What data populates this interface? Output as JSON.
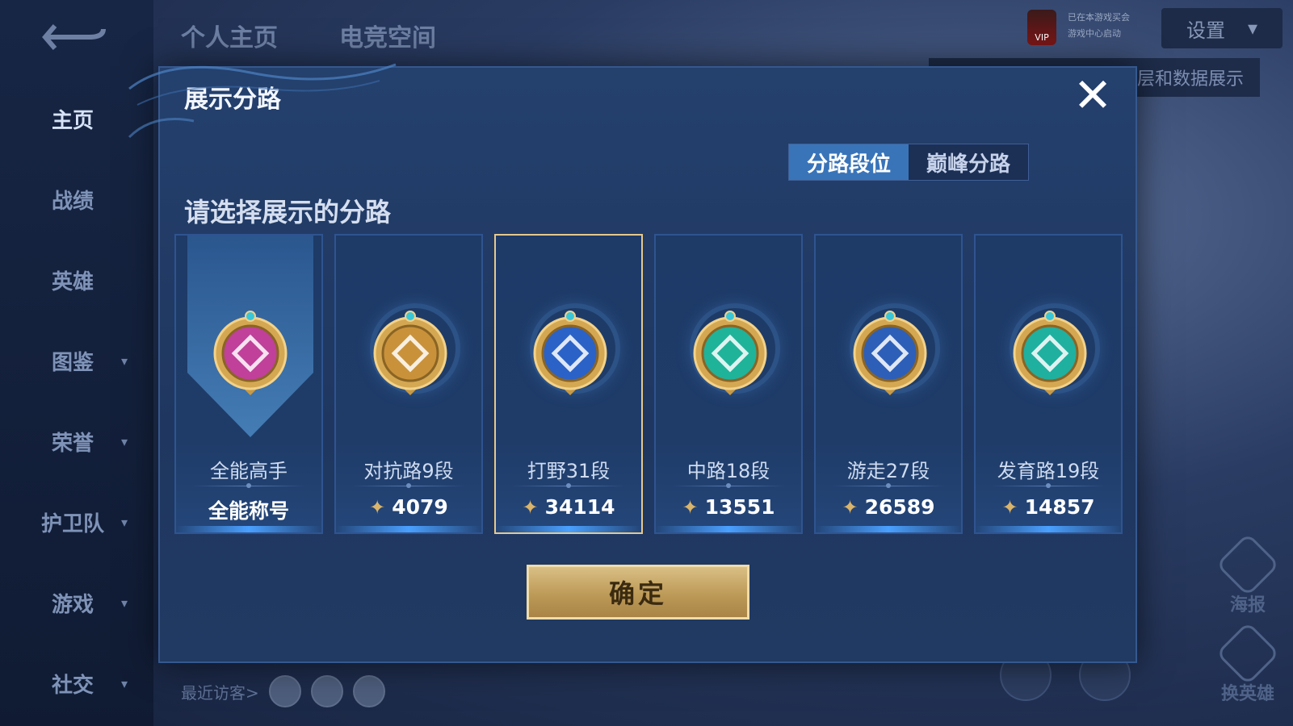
{
  "sidebar": {
    "items": [
      {
        "label": "主页",
        "has_chevron": false,
        "active": true
      },
      {
        "label": "战绩",
        "has_chevron": false
      },
      {
        "label": "英雄",
        "has_chevron": false
      },
      {
        "label": "图鉴",
        "has_chevron": true
      },
      {
        "label": "荣誉",
        "has_chevron": true
      },
      {
        "label": "护卫队",
        "has_chevron": true
      },
      {
        "label": "游戏",
        "has_chevron": true
      },
      {
        "label": "社交",
        "has_chevron": true
      }
    ]
  },
  "header": {
    "tabs": [
      "个人主页",
      "电竞空间"
    ],
    "vip_label": "VIP",
    "vip_text": [
      "已在本游戏买会",
      "游戏中心启动"
    ],
    "settings_label": "设置",
    "bg_tip": "层和数据展示"
  },
  "right_icons": [
    {
      "icon": "poster-icon",
      "label": "海报"
    },
    {
      "icon": "change-hero-icon",
      "label": "换英雄"
    }
  ],
  "visitors": {
    "label": "最近访客>"
  },
  "dialog": {
    "title": "展示分路",
    "close": "✕",
    "segments": [
      {
        "label": "分路段位",
        "selected": true
      },
      {
        "label": "巅峰分路",
        "selected": false
      }
    ],
    "prompt": "请选择展示的分路",
    "cards": [
      {
        "name": "全能高手",
        "value": "全能称号",
        "show_star": false,
        "emblem": "all-round-emblem-icon",
        "color": "#c0409a",
        "selected": false,
        "ribbon": true
      },
      {
        "name": "对抗路9段",
        "value": "4079",
        "show_star": true,
        "emblem": "clash-lane-emblem-icon",
        "color": "#c9923a",
        "selected": false
      },
      {
        "name": "打野31段",
        "value": "34114",
        "show_star": true,
        "emblem": "jungle-emblem-icon",
        "color": "#2a62c8",
        "selected": true
      },
      {
        "name": "中路18段",
        "value": "13551",
        "show_star": true,
        "emblem": "mid-lane-emblem-icon",
        "color": "#1fb39a",
        "selected": false
      },
      {
        "name": "游走27段",
        "value": "26589",
        "show_star": true,
        "emblem": "roam-emblem-icon",
        "color": "#2d5fb8",
        "selected": false
      },
      {
        "name": "发育路19段",
        "value": "14857",
        "show_star": true,
        "emblem": "farm-lane-emblem-icon",
        "color": "#1fb0a0",
        "selected": false
      }
    ],
    "confirm_label": "确定"
  },
  "colors": {
    "accent_blue": "#3974b9",
    "gold": "#e6c98c",
    "dialog_bg": "#203a63"
  }
}
